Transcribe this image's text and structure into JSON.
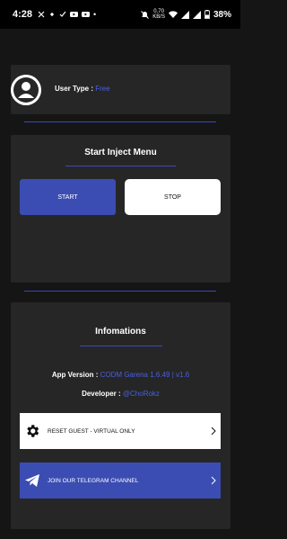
{
  "status_bar": {
    "time": "4:28",
    "net_speed": "0.70",
    "net_unit": "KB/S",
    "battery": "38%"
  },
  "user": {
    "label": "User Type :",
    "value": "Free"
  },
  "inject": {
    "title": "Start Inject Menu",
    "start_label": "START",
    "stop_label": "STOP"
  },
  "info": {
    "title": "Infomations",
    "app_version_label": "App Version :",
    "app_version_value": "CODM Garena 1.6.49 | v1.6",
    "developer_label": "Developer :",
    "developer_value": "@ChoRokz",
    "reset_label": "RESET GUEST - VIRTUAL ONLY",
    "telegram_label": "JOIN OUR TELEGRAM CHANNEL"
  },
  "colors": {
    "accent": "#3b4db3",
    "link": "#4a5fe0",
    "card": "#262626",
    "background": "#151515"
  },
  "icons": [
    "gear-icon",
    "telegram-icon",
    "chevron-right-icon",
    "avatar-icon"
  ]
}
